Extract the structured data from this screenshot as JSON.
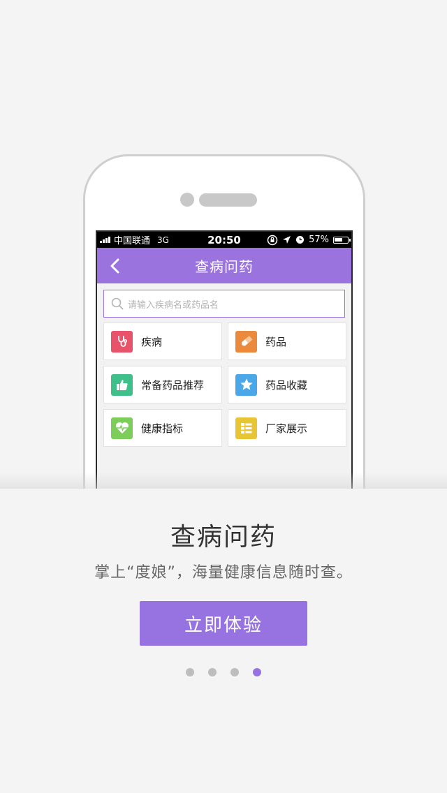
{
  "status_bar": {
    "carrier": "中国联通",
    "network": "3G",
    "time": "20:50",
    "battery": "57%",
    "battery_level": 0.57
  },
  "app": {
    "title": "查病问药",
    "search_placeholder": "请输入疾病名或药品名",
    "menu": [
      {
        "label": "疾病",
        "icon": "stethoscope-icon",
        "color": "#e8536b"
      },
      {
        "label": "药品",
        "icon": "pill-icon",
        "color": "#eb8a3c"
      },
      {
        "label": "常备药品推荐",
        "icon": "thumbs-up-icon",
        "color": "#3fbf8a"
      },
      {
        "label": "药品收藏",
        "icon": "star-icon",
        "color": "#4aa8e8"
      },
      {
        "label": "健康指标",
        "icon": "heart-pulse-icon",
        "color": "#7ccd5a"
      },
      {
        "label": "厂家展示",
        "icon": "list-icon",
        "color": "#e8c535"
      }
    ]
  },
  "intro": {
    "headline": "查病问药",
    "subline": "掌上“度娘”，海量健康信息随时查。",
    "cta_label": "立即体验",
    "page_count": 4,
    "active_page": 4
  },
  "colors": {
    "accent": "#9673e0",
    "nav": "#9b73df"
  }
}
